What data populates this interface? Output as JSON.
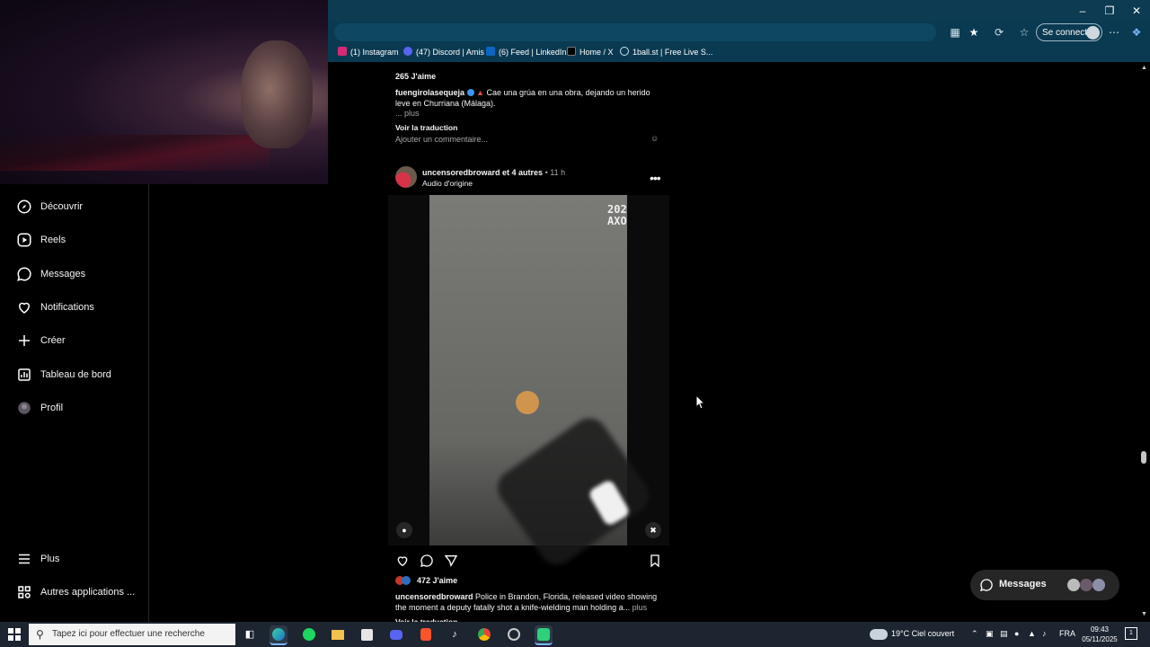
{
  "browser": {
    "login_label": "Se connecter",
    "bookmarks": [
      {
        "label": "(1) Instagram",
        "icon": "instagram-icon",
        "color": "#d62976"
      },
      {
        "label": "(47) Discord | Amis",
        "icon": "discord-icon",
        "color": "#5865f2"
      },
      {
        "label": "(6) Feed | LinkedIn",
        "icon": "linkedin-icon",
        "color": "#0a66c2"
      },
      {
        "label": "Home / X",
        "icon": "x-icon",
        "color": "#000000"
      },
      {
        "label": "1ball.st | Free Live S...",
        "icon": "globe-icon",
        "color": "#0a3a51"
      }
    ]
  },
  "sidebar": {
    "items": [
      {
        "label": "Découvrir",
        "icon": "compass-icon"
      },
      {
        "label": "Reels",
        "icon": "reels-icon"
      },
      {
        "label": "Messages",
        "icon": "messenger-icon"
      },
      {
        "label": "Notifications",
        "icon": "heart-icon"
      },
      {
        "label": "Créer",
        "icon": "plus-icon"
      },
      {
        "label": "Tableau de bord",
        "icon": "dashboard-icon"
      },
      {
        "label": "Profil",
        "icon": "avatar-icon"
      }
    ],
    "more_label": "Plus",
    "apps_label": "Autres applications ..."
  },
  "prev_post": {
    "likes": "265 J'aime",
    "username": "fuengirolasequeja",
    "caption_line1": "Cae una grúa en una obra, dejando un herido",
    "caption_line2": "leve en Churriana (Málaga).",
    "more": "... plus",
    "translate": "Voir la traduction",
    "comment_placeholder": "Ajouter un commentaire..."
  },
  "post": {
    "author": "uncensoredbroward",
    "coauthors": "et 4 autres",
    "dot": "•",
    "time": "11 h",
    "audio": "Audio d'origine",
    "video_stamp_1": "202",
    "video_stamp_2": "AXO",
    "likes": "472 J'aime",
    "caption_user": "uncensoredbroward",
    "caption_line1": "Police in Brandon, Florida, released video showing",
    "caption_line2": "the moment a deputy fatally shot a knife-wielding man holding a...",
    "more": "plus",
    "translate_partial": "Voir la traduction"
  },
  "messages_pill": {
    "label": "Messages"
  },
  "taskbar": {
    "search_placeholder": "Tapez ici pour effectuer une recherche",
    "weather_temp": "19°C",
    "weather_desc": "Ciel couvert",
    "language": "FRA",
    "time": "09:43",
    "date": "05/11/2025",
    "notification_count": "1"
  }
}
